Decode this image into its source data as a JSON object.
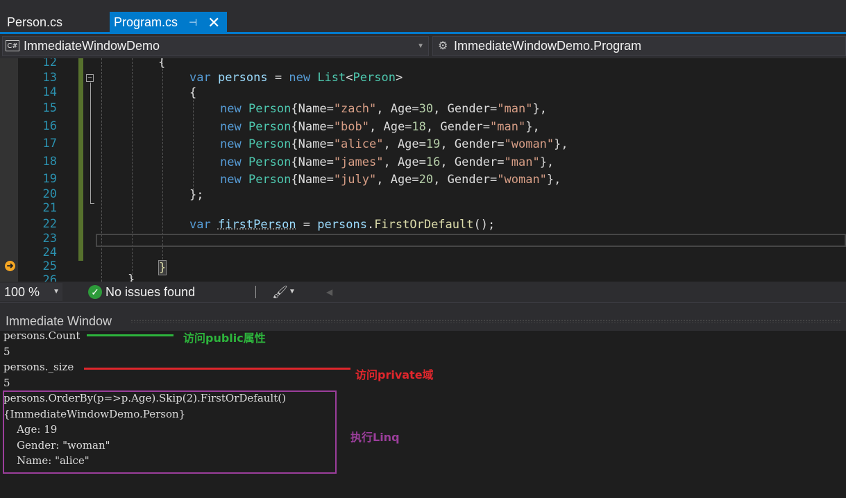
{
  "tabs": [
    {
      "label": "Person.cs",
      "active": false
    },
    {
      "label": "Program.cs",
      "active": true
    }
  ],
  "tab_icons": {
    "pin": "⊣",
    "close": "✕"
  },
  "nav": {
    "project_badge": "C#",
    "project": "ImmediateWindowDemo",
    "class": "ImmediateWindowDemo.Program"
  },
  "editor": {
    "line_numbers": [
      "12",
      "13",
      "14",
      "15",
      "16",
      "17",
      "18",
      "19",
      "20",
      "21",
      "22",
      "23",
      "24",
      "25",
      "26"
    ],
    "code": {
      "l12_brace": "{",
      "l13": {
        "kw_var": "var",
        "name": "persons",
        "eq": " = ",
        "kw_new": "new",
        "type_list": "List",
        "lt": "<",
        "type_person": "Person",
        "gt": ">"
      },
      "l14_brace": "{",
      "rows": [
        {
          "kw": "new",
          "type": "Person",
          "p1": "{Name=",
          "name": "\"zach\"",
          "p2": ", Age=",
          "age": "30",
          "p3": ", Gender=",
          "gender": "\"man\"",
          "p4": "},"
        },
        {
          "kw": "new",
          "type": "Person",
          "p1": "{Name=",
          "name": "\"bob\"",
          "p2": ", Age=",
          "age": "18",
          "p3": ", Gender=",
          "gender": "\"man\"",
          "p4": "},"
        },
        {
          "kw": "new",
          "type": "Person",
          "p1": "{Name=",
          "name": "\"alice\"",
          "p2": ", Age=",
          "age": "19",
          "p3": ", Gender=",
          "gender": "\"woman\"",
          "p4": "},"
        },
        {
          "kw": "new",
          "type": "Person",
          "p1": "{Name=",
          "name": "\"james\"",
          "p2": ", Age=",
          "age": "16",
          "p3": ", Gender=",
          "gender": "\"man\"",
          "p4": "},"
        },
        {
          "kw": "new",
          "type": "Person",
          "p1": "{Name=",
          "name": "\"july\"",
          "p2": ", Age=",
          "age": "20",
          "p3": ", Gender=",
          "gender": "\"woman\"",
          "p4": "},"
        }
      ],
      "l20_close": "};",
      "l22": {
        "kw_var": "var",
        "name": "firstPerson",
        "eq": " = ",
        "obj": "persons",
        "dot": ".",
        "method": "FirstOrDefault",
        "tail": "();"
      },
      "l25_brace": "}",
      "l26_brace": "}"
    }
  },
  "status": {
    "zoom": "100 %",
    "issues": "No issues found"
  },
  "immediate": {
    "title": "Immediate Window",
    "lines": [
      "persons.Count",
      "5",
      "persons._size",
      "5",
      "persons.OrderBy(p=>p.Age).Skip(2).FirstOrDefault()",
      "{ImmediateWindowDemo.Person}",
      "    Age: 19",
      "    Gender: \"woman\"",
      "    Name: \"alice\""
    ]
  },
  "annotations": {
    "public_label": "访问public属性",
    "private_label": "访问private域",
    "linq_label": "执行Linq"
  },
  "colors": {
    "accent": "#007acc",
    "annotation_green": "#2db43c",
    "annotation_red": "#e0262c",
    "annotation_purple": "#9b3e9b"
  }
}
